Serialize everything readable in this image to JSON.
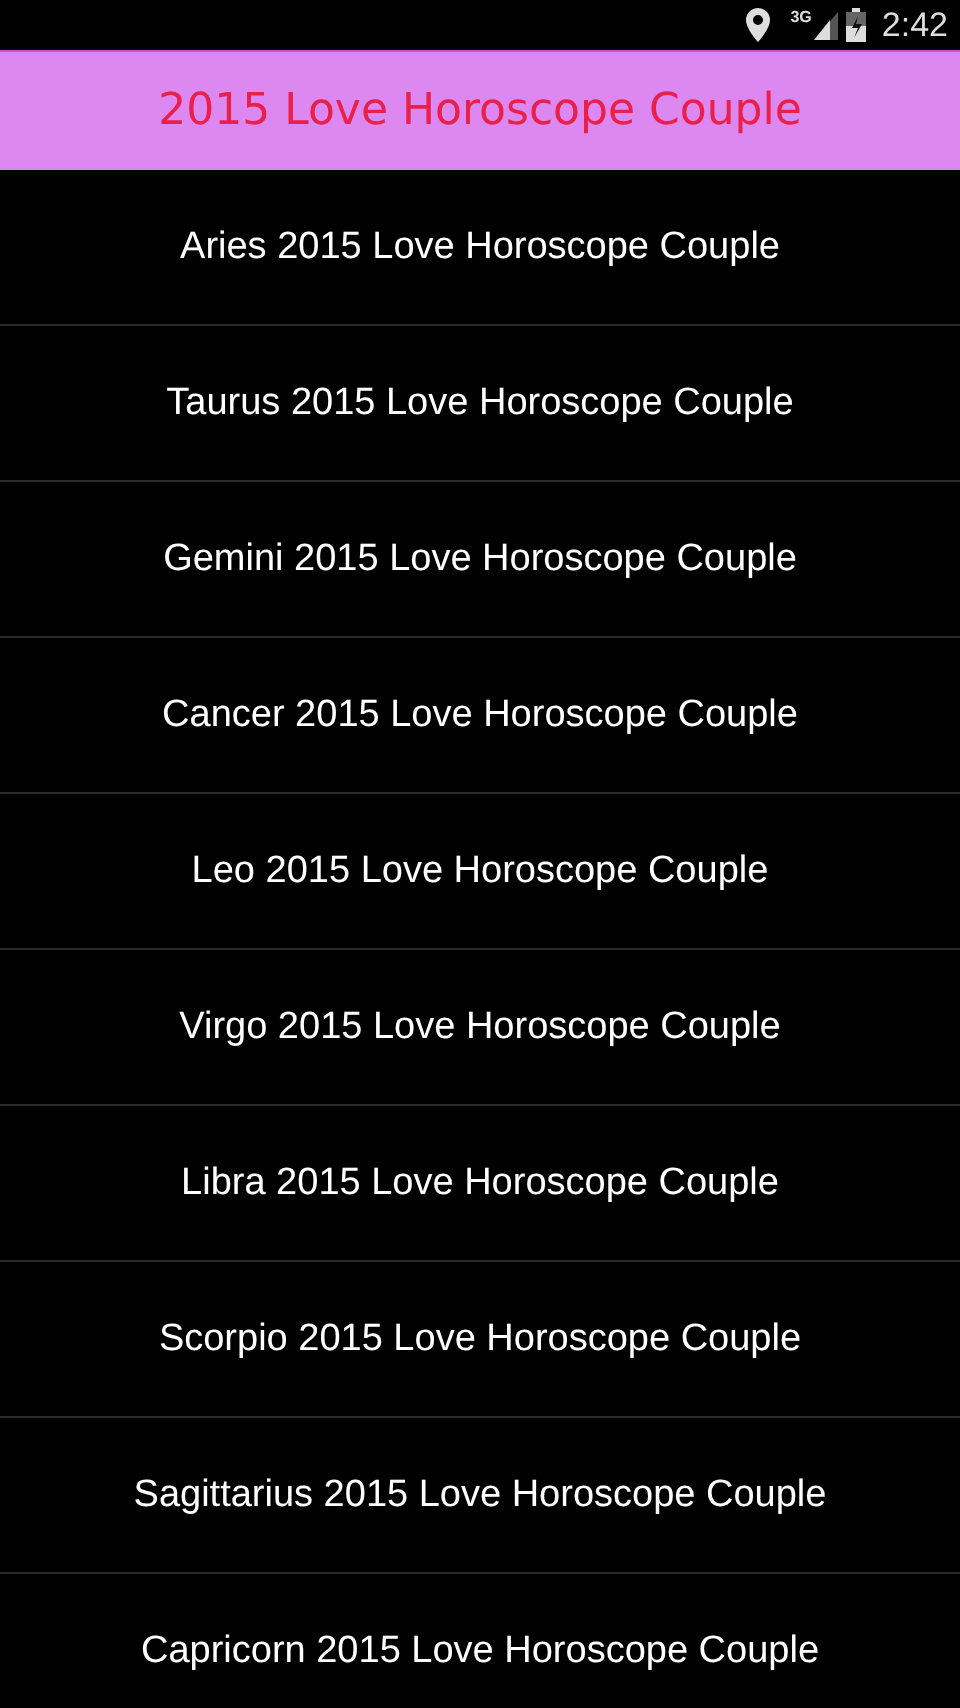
{
  "status_bar": {
    "network": "3G",
    "time": "2:42"
  },
  "title": "2015 Love Horoscope Couple",
  "items": [
    {
      "label": "Aries 2015 Love Horoscope Couple"
    },
    {
      "label": "Taurus 2015 Love Horoscope Couple"
    },
    {
      "label": "Gemini 2015 Love Horoscope Couple"
    },
    {
      "label": "Cancer 2015 Love Horoscope Couple"
    },
    {
      "label": "Leo 2015 Love Horoscope Couple"
    },
    {
      "label": "Virgo 2015 Love Horoscope Couple"
    },
    {
      "label": "Libra 2015 Love Horoscope Couple"
    },
    {
      "label": "Scorpio 2015 Love Horoscope Couple"
    },
    {
      "label": "Sagittarius 2015 Love Horoscope Couple"
    },
    {
      "label": "Capricorn 2015 Love Horoscope Couple"
    }
  ]
}
